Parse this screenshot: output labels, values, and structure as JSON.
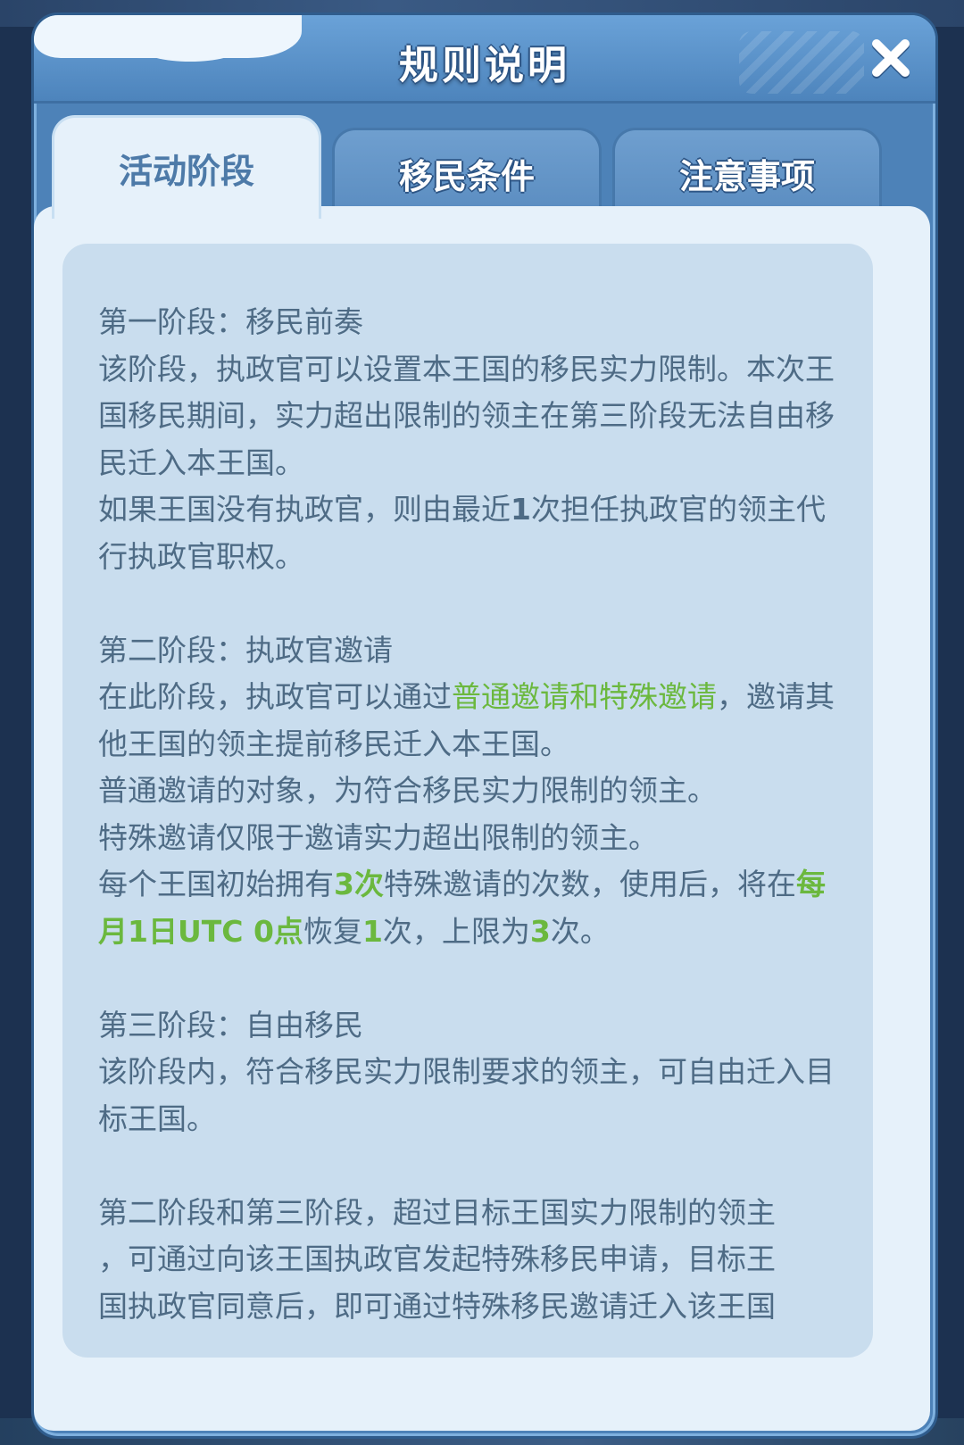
{
  "dialog": {
    "title": "规则说明",
    "close_icon": "close-icon"
  },
  "tabs": [
    {
      "label": "活动阶段",
      "active": true
    },
    {
      "label": "移民条件",
      "active": false
    },
    {
      "label": "注意事项",
      "active": false
    }
  ],
  "content": {
    "stage1": {
      "heading": "第一阶段：移民前奏",
      "p1": "该阶段，执政官可以设置本王国的移民实力限制。本次王国移民期间，实力超出限制的领主在第三阶段无法自由移民迁入本王国。",
      "p2_pre": "如果王国没有执政官，则由最近",
      "p2_num": "1",
      "p2_post": "次担任执政官的领主代行执政官职权。"
    },
    "stage2": {
      "heading": "第二阶段：执政官邀请",
      "p1_pre": "在此阶段，执政官可以通过",
      "p1_hl": "普通邀请和特殊邀请",
      "p1_post": "，邀请其他王国的领主提前移民迁入本王国。",
      "p2": "普通邀请的对象，为符合移民实力限制的领主。",
      "p3": "特殊邀请仅限于邀请实力超出限制的领主。",
      "p4_a": "每个王国初始拥有",
      "p4_b": "3次",
      "p4_c": "特殊邀请的次数，使用后，将在",
      "p4_d": "每月1日UTC 0点",
      "p4_e": "恢复",
      "p4_f": "1",
      "p4_g": "次，上限为",
      "p4_h": "3",
      "p4_i": "次。"
    },
    "stage3": {
      "heading": "第三阶段：自由移民",
      "p1": "该阶段内，符合移民实力限制要求的领主，可自由迁入目标王国。"
    },
    "note": {
      "line1": "第二阶段和第三阶段，超过目标王国实力限制的领主",
      "line2": "，可通过向该王国执政官发起特殊移民申请，目标王",
      "line3": "国执政官同意后，即可通过特殊移民邀请迁入该王国"
    }
  },
  "colors": {
    "frame": "#4d82b8",
    "panel": "#e6f1fa",
    "content_box": "#c9ddee",
    "text": "#4e6b85",
    "highlight": "#6bb83e"
  }
}
